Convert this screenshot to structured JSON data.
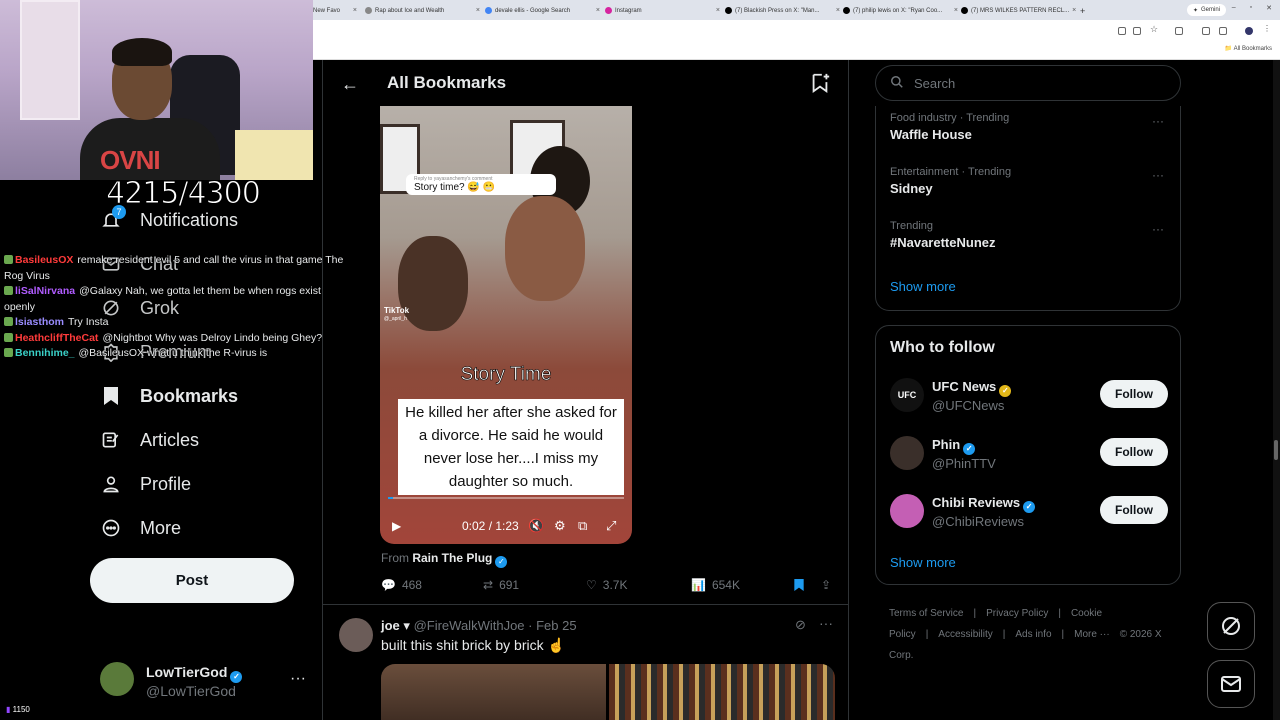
{
  "browser": {
    "tabs": [
      {
        "label": "New Favo"
      },
      {
        "label": "Rap about Ice and Wealth"
      },
      {
        "label": "devale ellis - Google Search"
      },
      {
        "label": "Instagram"
      },
      {
        "label": "(7) Blackish Press on X: \"Man..."
      },
      {
        "label": "(7) philip lewis on X: \"Ryan Coo..."
      },
      {
        "label": "(7) MRS WILKES PATTERN RECL..."
      }
    ],
    "gemini_label": "Gemini",
    "all_bookmarks_label": "All Bookmarks"
  },
  "stream": {
    "goal_counter": "4215/4300",
    "viewer_count": "1150",
    "chat": [
      {
        "user": "BasileusOX",
        "color": "#ff3b3b",
        "message": "remake resident evil 5 and call the virus in that game The Rog Virus"
      },
      {
        "user": "liSalNirvana",
        "color": "#b05cff",
        "message": "@Galaxy Nah, we gotta let them be when rogs exist openly"
      },
      {
        "user": "lsiasthom",
        "color": "#9a8cff",
        "message": "Try Insta"
      },
      {
        "user": "HeathcliffTheCat",
        "color": "#ff3b3b",
        "message": "@Nightbot Why was Delroy Lindo being Ghey?"
      },
      {
        "user": "Bennihime_",
        "color": "#3ad1c8",
        "message": "@BasileusOX what u think the R-virus is"
      }
    ]
  },
  "nav": {
    "items": [
      {
        "label": "Notifications",
        "badge": "7"
      },
      {
        "label": "Chat"
      },
      {
        "label": "Grok"
      },
      {
        "label": "Premium"
      },
      {
        "label": "Bookmarks"
      },
      {
        "label": "Articles"
      },
      {
        "label": "Profile"
      },
      {
        "label": "More"
      }
    ],
    "post_label": "Post",
    "account": {
      "name": "LowTierGod",
      "handle": "@LowTierGod"
    }
  },
  "header": {
    "title": "All Bookmarks"
  },
  "tweet1": {
    "video": {
      "reply_to": "Reply to yayasanchemy's comment",
      "reply_text": "Story time? 😅 😬",
      "tiktok": "TikTok",
      "tiktok_user": "@_april_h",
      "story_time": "Story Time",
      "caption": "He killed her after she asked for a divorce. He said he would never lose her....I miss my daughter so much.",
      "time": "0:02 / 1:23",
      "progress": 0.02
    },
    "from_prefix": "From",
    "from_name": "Rain The Plug",
    "replies": "468",
    "reposts": "691",
    "likes": "3.7K",
    "views": "654K"
  },
  "tweet2": {
    "name": "joe",
    "handle": "@FireWalkWithJoe",
    "date": "Feb 25",
    "text": "built this shit brick by brick ☝️"
  },
  "sidebar": {
    "search_placeholder": "Search",
    "trends": [
      {
        "meta": "Food industry · Trending",
        "name": "Waffle House"
      },
      {
        "meta": "Entertainment · Trending",
        "name": "Sidney"
      },
      {
        "meta": "Trending",
        "name": "#NavaretteNunez"
      }
    ],
    "show_more": "Show more",
    "who_to_follow_title": "Who to follow",
    "follow": [
      {
        "name": "UFC News",
        "handle": "@UFCNews",
        "button": "Follow",
        "badge": "gold"
      },
      {
        "name": "Phin",
        "handle": "@PhinTTV",
        "button": "Follow",
        "badge": "blue"
      },
      {
        "name": "Chibi Reviews",
        "handle": "@ChibiReviews",
        "button": "Follow",
        "badge": "blue"
      }
    ],
    "show_more_2": "Show more",
    "footer": [
      "Terms of Service",
      "|",
      "Privacy Policy",
      "|",
      "Cookie Policy",
      "|",
      "Accessibility",
      "|",
      "Ads info",
      "|",
      "More ···",
      "© 2026 X Corp."
    ]
  },
  "colors": {
    "accent": "#1d9bf0",
    "background": "#000000",
    "text": "#e7e9ea",
    "muted": "#71767b"
  }
}
